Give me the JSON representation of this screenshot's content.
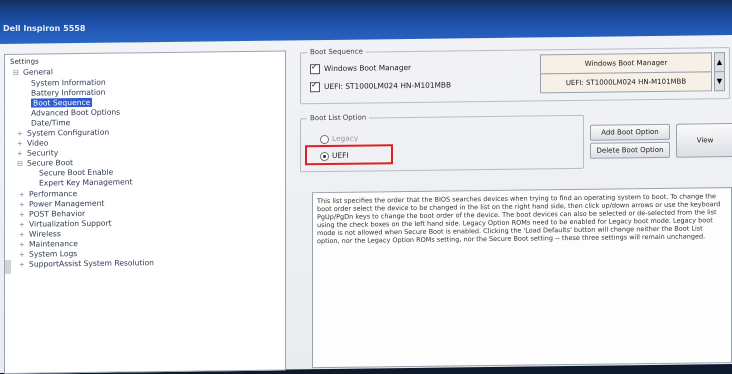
{
  "window": {
    "title": "Dell Inspiron 5558"
  },
  "tree": {
    "header": "Settings",
    "items": [
      {
        "label": "General",
        "prefix": "⊟"
      },
      {
        "label": "System Information",
        "prefix": ""
      },
      {
        "label": "Battery Information",
        "prefix": ""
      },
      {
        "label": "Boot Sequence",
        "prefix": ""
      },
      {
        "label": "Advanced Boot Options",
        "prefix": ""
      },
      {
        "label": "Date/Time",
        "prefix": ""
      },
      {
        "label": "System Configuration",
        "prefix": "+"
      },
      {
        "label": "Video",
        "prefix": "+"
      },
      {
        "label": "Security",
        "prefix": "+"
      },
      {
        "label": "Secure Boot",
        "prefix": "⊟"
      },
      {
        "label": "Secure Boot Enable",
        "prefix": ""
      },
      {
        "label": "Expert Key Management",
        "prefix": ""
      },
      {
        "label": "Performance",
        "prefix": "+"
      },
      {
        "label": "Power Management",
        "prefix": "+"
      },
      {
        "label": "POST Behavior",
        "prefix": "+"
      },
      {
        "label": "Virtualization Support",
        "prefix": "+"
      },
      {
        "label": "Wireless",
        "prefix": "+"
      },
      {
        "label": "Maintenance",
        "prefix": "+"
      },
      {
        "label": "System Logs",
        "prefix": "+"
      },
      {
        "label": "SupportAssist System Resolution",
        "prefix": "+"
      }
    ]
  },
  "boot_sequence": {
    "caption": "Boot Sequence",
    "entries": [
      "Windows Boot Manager",
      "UEFI: ST1000LM024 HN-M101MBB"
    ],
    "order": [
      "Windows Boot Manager",
      "UEFI: ST1000LM024 HN-M101MBB"
    ]
  },
  "boot_list": {
    "caption": "Boot List Option",
    "legacy": "Legacy",
    "uefi": "UEFI",
    "selected": "UEFI"
  },
  "buttons": {
    "add": "Add Boot Option",
    "delete": "Delete Boot Option",
    "view": "View"
  },
  "description": "This list specifies the order that the BIOS searches devices when trying to find an operating system to boot. To change the boot order select the device to be changed in the list on the right hand side, then click up/down arrows or use the keyboard PgUp/PgDn keys to change the boot order of the device. The boot devices can also be selected or de-selected from the list using the check boxes on the left hand side. Legacy Option ROMs need to be enabled for Legacy boot mode. Legacy boot mode is not allowed when Secure Boot is enabled. Clicking the 'Load Defaults' button will change neither the Boot List option, nor the Legacy Option ROMs setting, nor the Secure Boot setting -- these three settings will remain unchanged.",
  "colors": {
    "highlight": "#e02020",
    "selection": "#2d5bd2",
    "titlebar": "#1a4ba0"
  }
}
